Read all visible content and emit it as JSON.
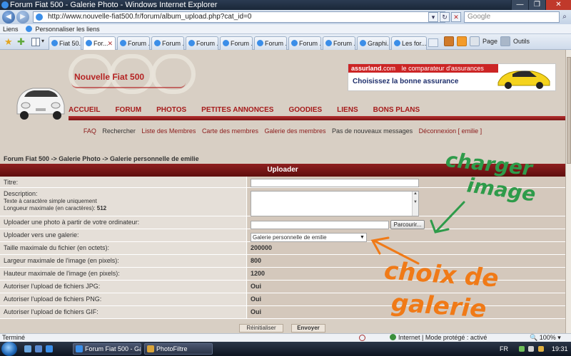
{
  "window": {
    "title": "Forum Fiat 500 - Galerie Photo - Windows Internet Explorer"
  },
  "address_bar": {
    "url": "http://www.nouvelle-fiat500.fr/forum/album_upload.php?cat_id=0",
    "search_placeholder": "Google"
  },
  "links_bar": {
    "items": [
      "Liens",
      "Personnaliser les liens"
    ]
  },
  "tabs": {
    "items": [
      {
        "label": "Fiat 50..."
      },
      {
        "label": "For..."
      },
      {
        "label": "Forum ..."
      },
      {
        "label": "Forum ..."
      },
      {
        "label": "Forum ..."
      },
      {
        "label": "Forum ..."
      },
      {
        "label": "Forum ..."
      },
      {
        "label": "Forum ..."
      },
      {
        "label": "Forum ..."
      },
      {
        "label": "Graphi..."
      },
      {
        "label": "Les for..."
      }
    ],
    "page_menu": "Page",
    "tools_menu": "Outils"
  },
  "site": {
    "logo_text": "Nouvelle Fiat 500",
    "banner": {
      "brand": "assurland",
      "brand_suffix": ".com",
      "tagline": "le comparateur d'assurances",
      "slogan": "Choisissez la bonne assurance"
    },
    "main_nav": [
      "ACCUEIL",
      "FORUM",
      "PHOTOS",
      "PETITES ANNONCES",
      "GOODIES",
      "LIENS",
      "BONS PLANS"
    ],
    "sub_nav": [
      "FAQ",
      "Rechercher",
      "Liste des Membres",
      "Carte des membres",
      "Galerie des membres",
      "Pas de nouveaux messages",
      "Déconnexion [ emilie ]"
    ]
  },
  "breadcrumb": "Forum Fiat 500 -> Galerie Photo -> Galerie personnelle de emilie",
  "form": {
    "header": "Uploader",
    "title_label": "Titre:",
    "desc_label": "Description:",
    "desc_note1": "Texte à caractère simple uniquement",
    "desc_note2": "Longueur maximale (en caractères):",
    "desc_maxlen": "512",
    "upload_label": "Uploader une photo à partir de votre ordinateur:",
    "browse_label": "Parcourir...",
    "gallery_label": "Uploader vers une galerie:",
    "gallery_selected": "Galerie personnelle de emilie",
    "rows": [
      {
        "label": "Taille maximale du fichier (en octets):",
        "value": "200000"
      },
      {
        "label": "Largeur maximale de l'image (en pixels):",
        "value": "800"
      },
      {
        "label": "Hauteur maximale de l'image (en pixels):",
        "value": "1200"
      },
      {
        "label": "Autoriser l'upload de fichiers JPG:",
        "value": "Oui"
      },
      {
        "label": "Autoriser l'upload de fichiers PNG:",
        "value": "Oui"
      },
      {
        "label": "Autoriser l'upload de fichiers GIF:",
        "value": "Oui"
      }
    ],
    "reset_label": "Réinitialiser",
    "submit_label": "Envoyer"
  },
  "annotations": {
    "green_line1": "charger",
    "green_line2": "image",
    "orange_line1": "choix de",
    "orange_line2": "galerie",
    "green_color": "#2e9b4a",
    "orange_color": "#f07a17"
  },
  "status_bar": {
    "status": "Terminé",
    "zone": "Internet | Mode protégé : activé",
    "zoom": "100%"
  },
  "taskbar": {
    "items": [
      "Forum Fiat 500 - Gal...",
      "PhotoFiltre"
    ],
    "lang": "FR",
    "clock": "19:31"
  },
  "colors": {
    "accent_red": "#a61b1b",
    "page_bg": "#d8cfc4",
    "form_header": "#7a1616"
  }
}
